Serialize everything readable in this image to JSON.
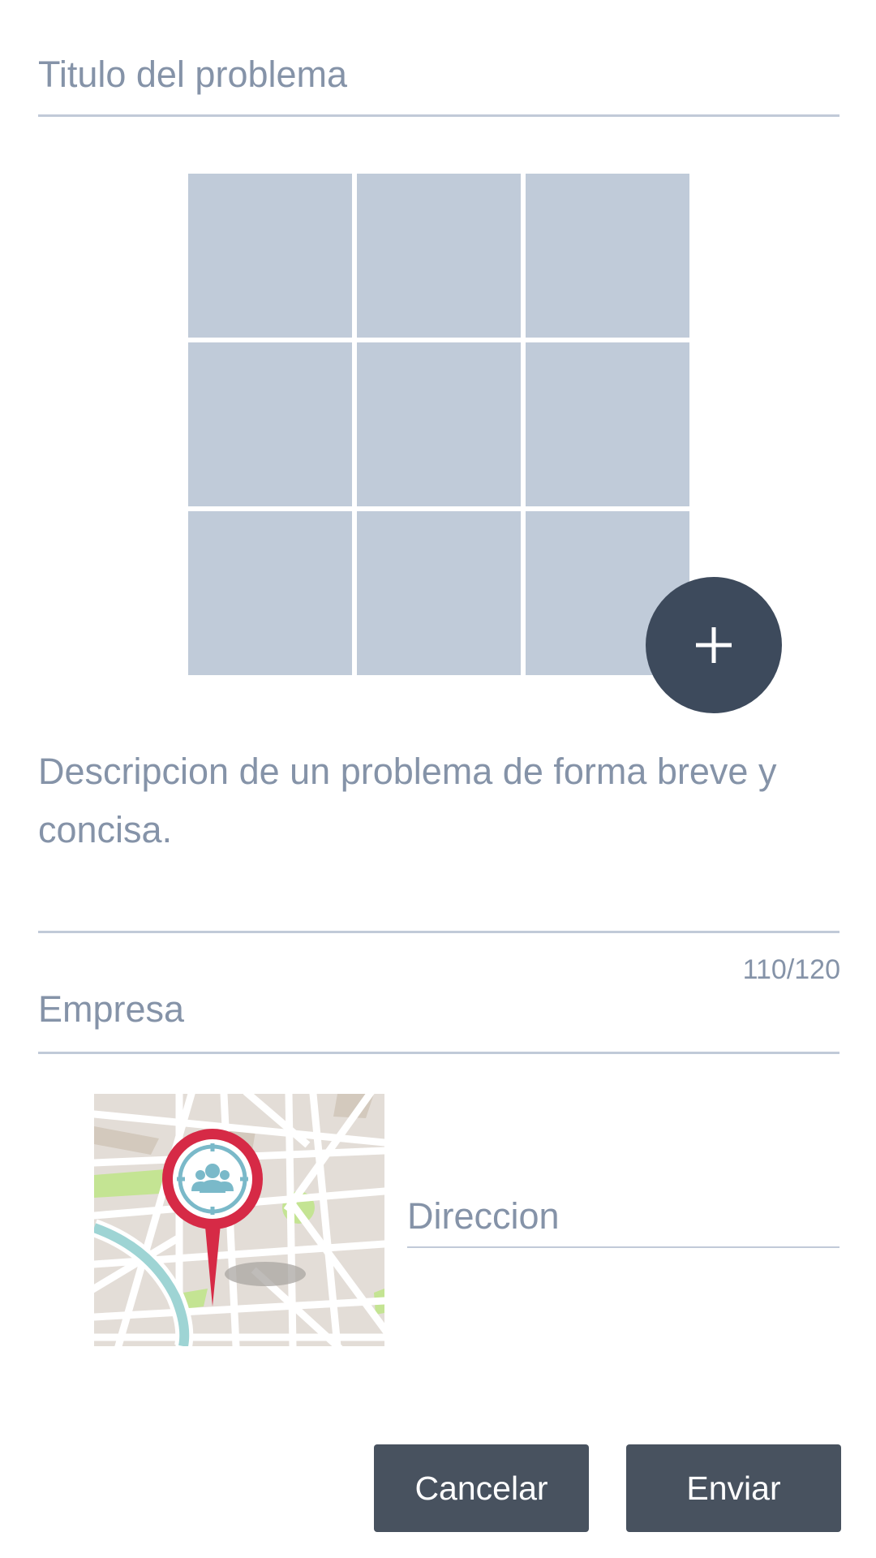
{
  "form": {
    "title_placeholder": "Titulo del problema",
    "description_placeholder": "Descripcion de un problema de forma breve y concisa.",
    "char_counter": "110/120",
    "company_placeholder": "Empresa",
    "address_placeholder": "Direccion"
  },
  "photos": {
    "grid_rows": 3,
    "grid_cols": 3,
    "add_icon": "plus-icon"
  },
  "location": {
    "map_icon": "map-pin-icon"
  },
  "actions": {
    "cancel_label": "Cancelar",
    "send_label": "Enviar"
  },
  "colors": {
    "placeholder_text": "#8593a8",
    "photo_slot": "#c0cbd9",
    "fab": "#3d4a5c",
    "button": "#48525f",
    "pin": "#d62a46"
  }
}
